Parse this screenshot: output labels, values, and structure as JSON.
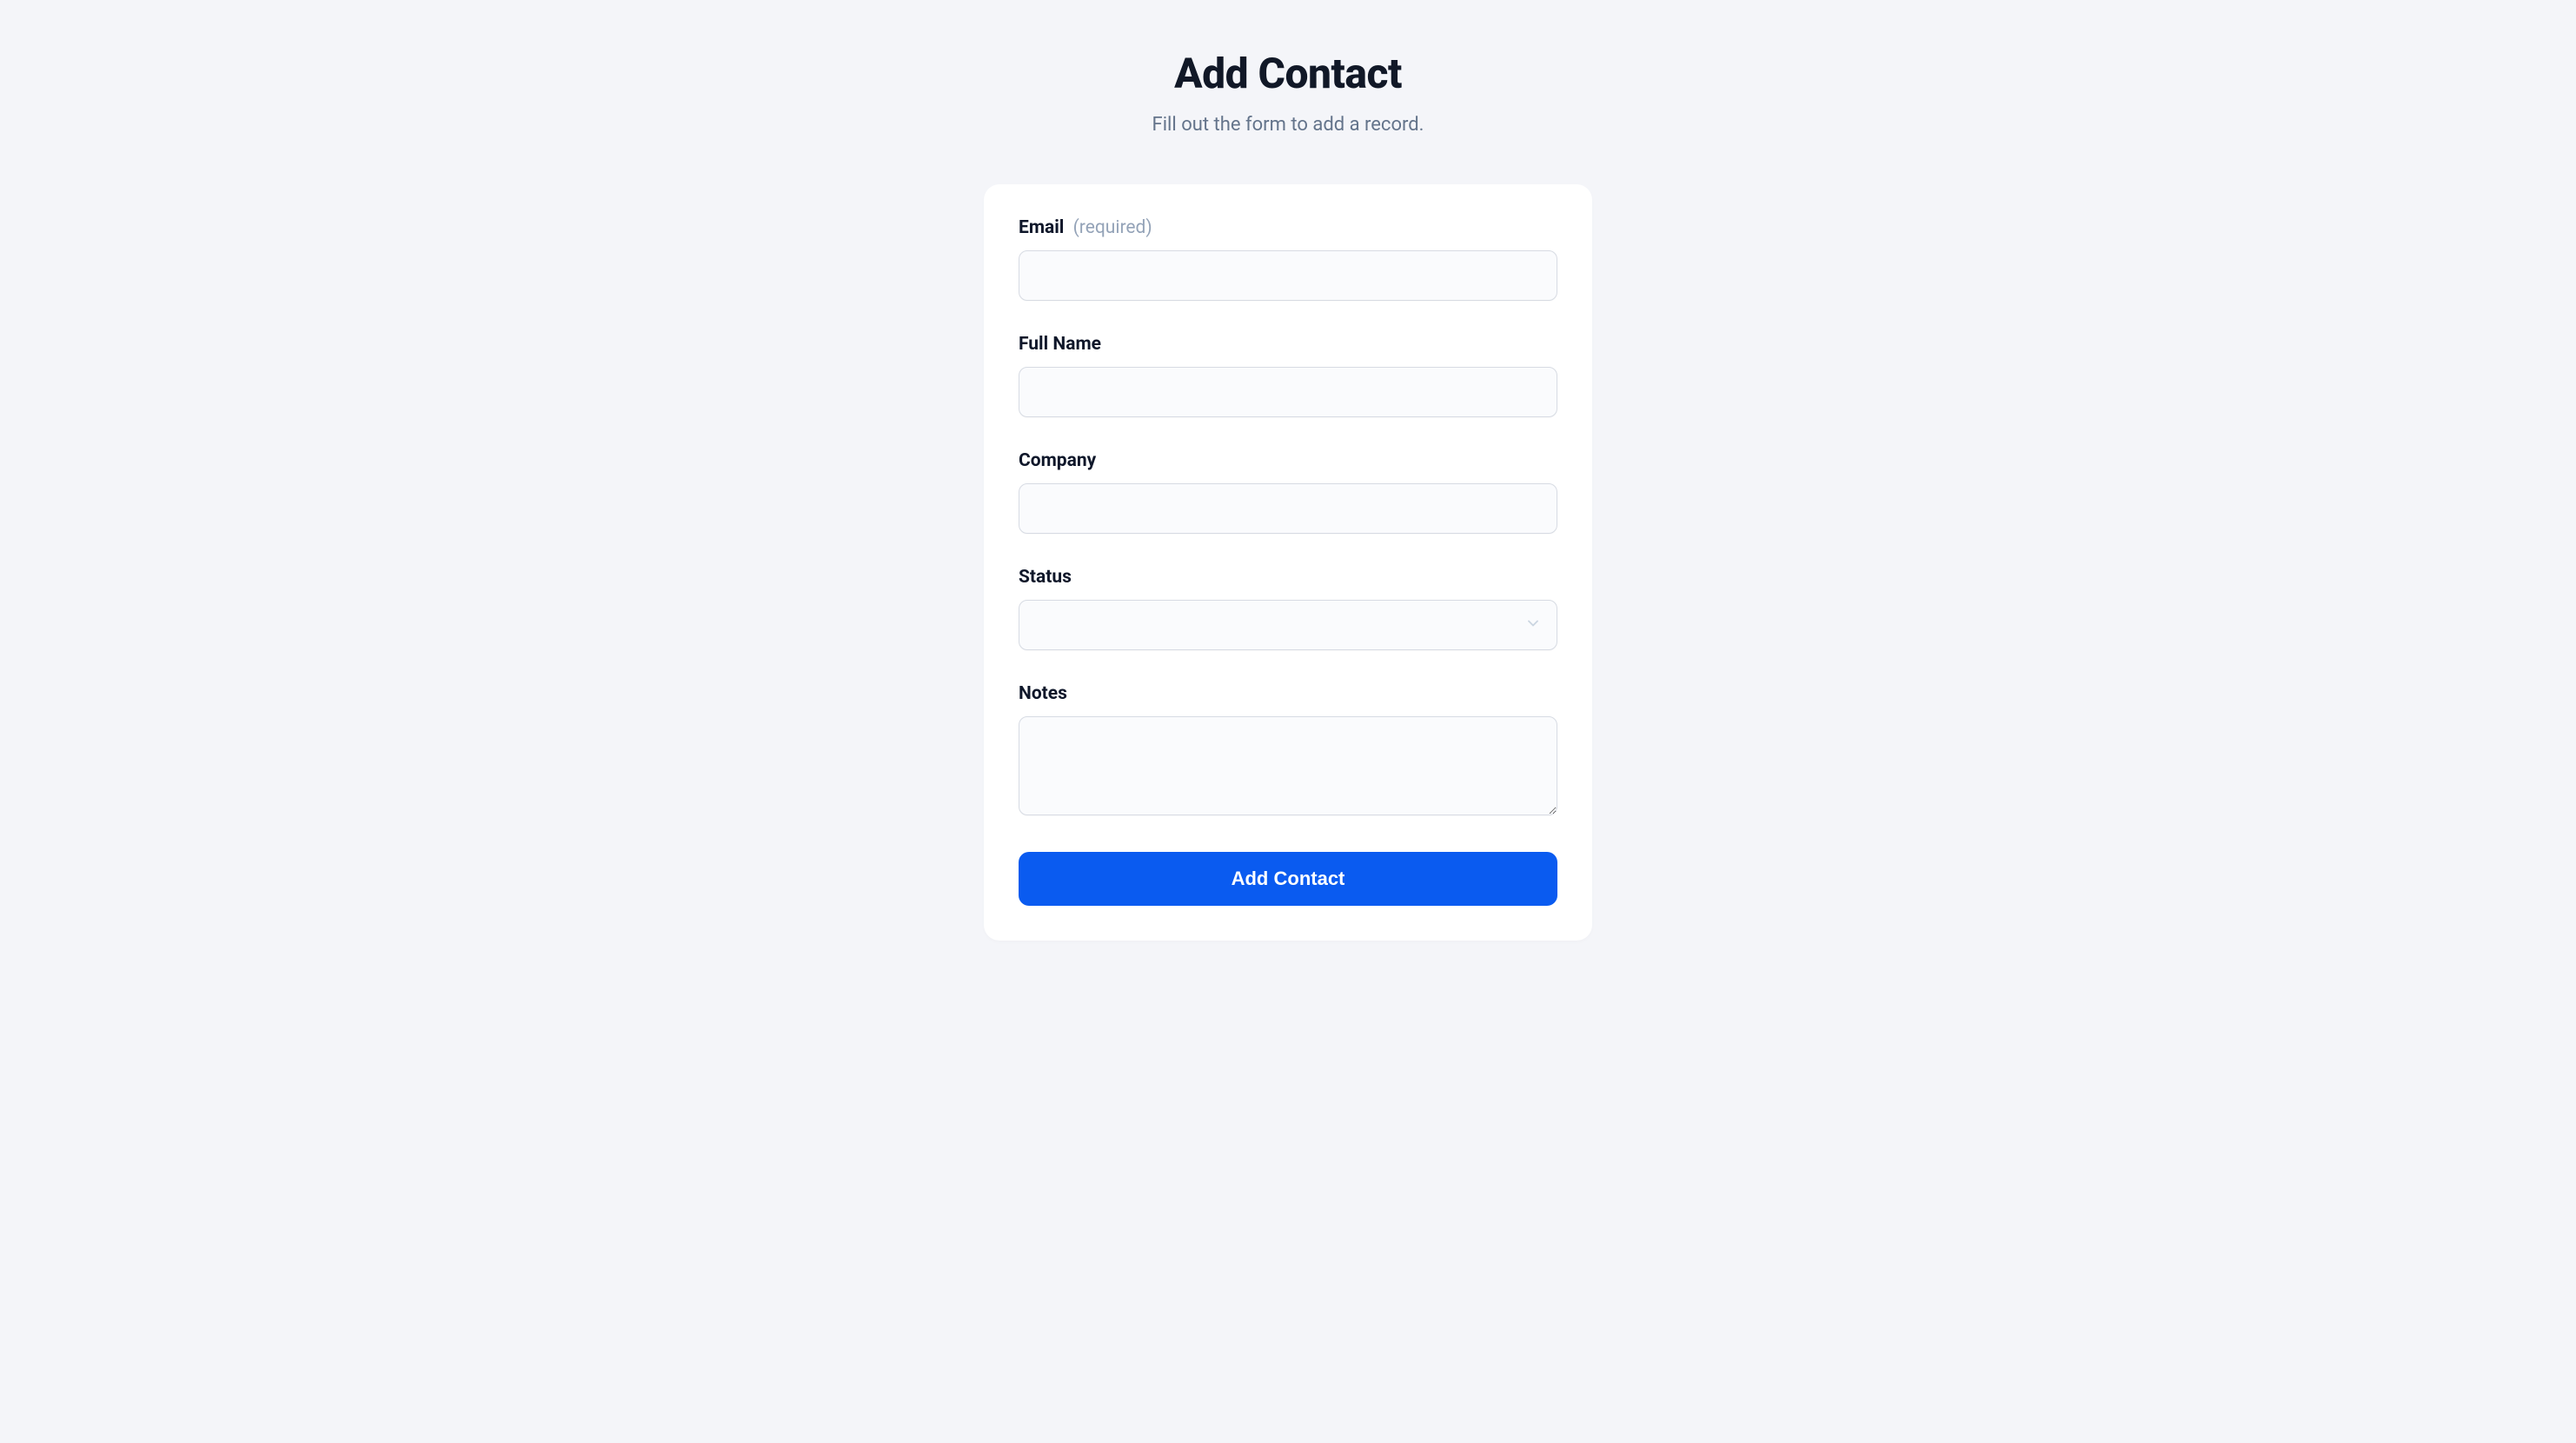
{
  "header": {
    "title": "Add Contact",
    "subtitle": "Fill out the form to add a record."
  },
  "form": {
    "fields": {
      "email": {
        "label": "Email",
        "required_tag": "(required)",
        "value": ""
      },
      "full_name": {
        "label": "Full Name",
        "value": ""
      },
      "company": {
        "label": "Company",
        "value": ""
      },
      "status": {
        "label": "Status",
        "selected": ""
      },
      "notes": {
        "label": "Notes",
        "value": ""
      }
    },
    "submit_label": "Add Contact"
  },
  "colors": {
    "page_bg": "#f4f5f9",
    "card_bg": "#ffffff",
    "title_color": "#111827",
    "subtitle_color": "#64748b",
    "label_color": "#0f172a",
    "required_color": "#94a3b8",
    "input_border": "#d7dbe3",
    "input_bg": "#fafbfd",
    "button_bg": "#0a5bf0",
    "button_text": "#ffffff"
  }
}
